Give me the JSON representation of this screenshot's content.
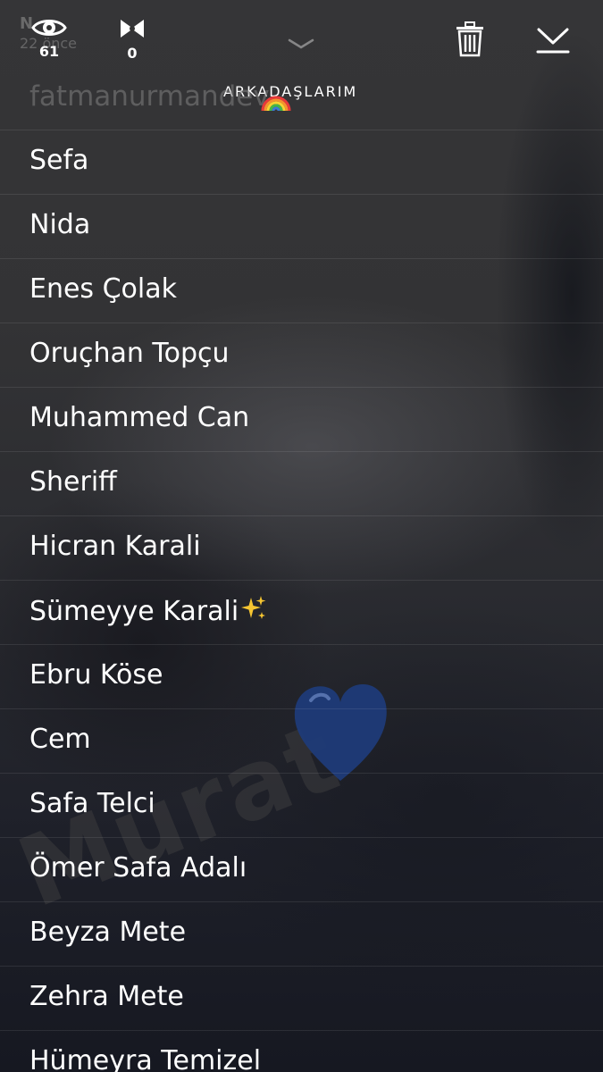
{
  "header": {
    "sender_name": "N",
    "sender_time": "22 önce",
    "views_count": "61",
    "screenshots_count": "0",
    "icons": {
      "views": "eye-icon",
      "screenshots": "screenshot-arrows-icon",
      "collapse": "chevron-down-icon",
      "delete": "trash-icon",
      "save": "download-icon"
    }
  },
  "story": {
    "title": "ARKADAŞLARIM",
    "title_emoji": "rainbow-emoji"
  },
  "viewers": {
    "first_partial": "fatmanurmandev",
    "items": [
      {
        "name": "Sefa"
      },
      {
        "name": "Nida"
      },
      {
        "name": "Enes Çolak"
      },
      {
        "name": "Oruçhan Topçu"
      },
      {
        "name": "Muhammed Can"
      },
      {
        "name": "Sheriff"
      },
      {
        "name": "Hicran Karali"
      },
      {
        "name": "Sümeyye Karali",
        "emoji": "sparkles-emoji"
      },
      {
        "name": "Ebru Köse"
      },
      {
        "name": "Cem"
      },
      {
        "name": "Safa Telci"
      },
      {
        "name": "Ömer Safa Adalı"
      },
      {
        "name": "Beyza Mete"
      },
      {
        "name": "Zehra Mete"
      },
      {
        "name": "Hümeyra Temizel"
      }
    ]
  },
  "overlay": {
    "watermark_text": "Murat",
    "heart_emoji": "blue-heart-emoji",
    "heart_color": "#1f3b78"
  }
}
